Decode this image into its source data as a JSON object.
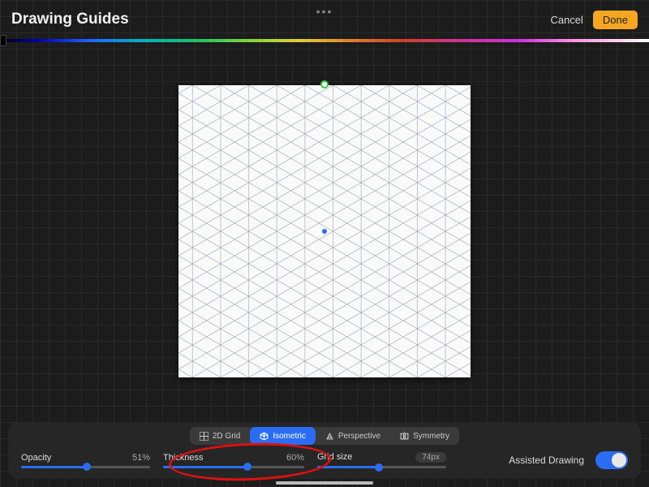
{
  "header": {
    "title": "Drawing Guides",
    "cancel_label": "Cancel",
    "done_label": "Done"
  },
  "guide_tabs": {
    "grid2d": "2D Grid",
    "isometric": "Isometric",
    "perspective": "Perspective",
    "symmetry": "Symmetry",
    "active": "isometric"
  },
  "sliders": {
    "opacity": {
      "label": "Opacity",
      "value_text": "51%",
      "percent": 51
    },
    "thickness": {
      "label": "Thickness",
      "value_text": "60%",
      "percent": 60
    },
    "gridsize": {
      "label": "Grid size",
      "value_text": "74px",
      "percent": 48
    }
  },
  "assisted": {
    "label": "Assisted Drawing",
    "on": true
  },
  "colors": {
    "accent": "#2a6df4",
    "done_btn": "#f5a623"
  }
}
